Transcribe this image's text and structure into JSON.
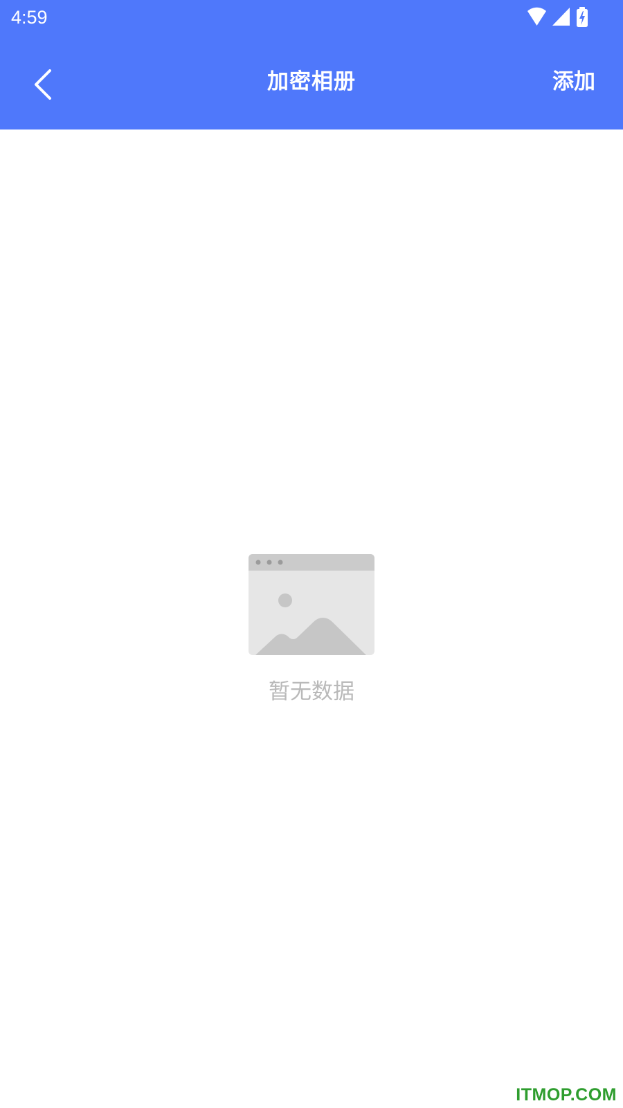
{
  "status_bar": {
    "time": "4:59",
    "icons": [
      "wifi-icon",
      "cellular-signal-icon",
      "battery-charging-icon"
    ]
  },
  "toolbar": {
    "back_icon": "chevron-left-icon",
    "title": "加密相册",
    "add_label": "添加"
  },
  "empty_state": {
    "illustration": "image-placeholder-icon",
    "message": "暂无数据"
  },
  "watermark": {
    "text": "ITMOP.COM"
  },
  "colors": {
    "header": "#4f78fb",
    "header_text": "#ffffff",
    "empty_text": "#b9b9b9",
    "watermark": "#2e9d2e"
  }
}
